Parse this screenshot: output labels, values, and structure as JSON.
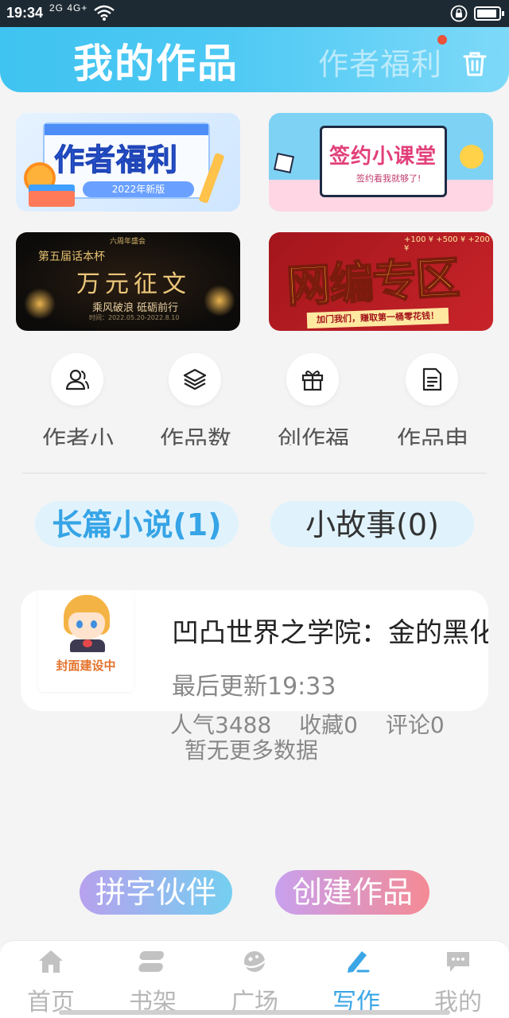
{
  "status": {
    "time": "19:34",
    "network": "2G 4G+"
  },
  "header": {
    "title": "我的作品",
    "welfare_link": "作者福利"
  },
  "banners": [
    {
      "title": "作者福利",
      "subtitle": "2022年新版"
    },
    {
      "title": "签约小课堂",
      "subtitle": "签约看我就够了!"
    },
    {
      "top_note": "六周年盛会",
      "left_text": "第五届话本杯",
      "title": "万元征文",
      "subtitle": "乘风破浪 砥砺前行",
      "date": "时间：2022.05.20-2022.8.10"
    },
    {
      "title": "网编专区",
      "ribbon": "加门我们，赚取第一桶零花钱！",
      "score": "+100 ¥   +500 ¥   +200 ¥"
    }
  ],
  "quick_links": [
    {
      "label": "作者小",
      "icon": "user-icon"
    },
    {
      "label": "作品数",
      "icon": "layers-icon"
    },
    {
      "label": "创作福",
      "icon": "gift-icon"
    },
    {
      "label": "作品申",
      "icon": "document-icon"
    }
  ],
  "tabs": [
    {
      "label": "长篇小说(1)",
      "active": true
    },
    {
      "label": "小故事(0)",
      "active": false
    }
  ],
  "work": {
    "cover_label": "封面建设中",
    "title": "凹凸世界之学院：金的黑化",
    "last_update": "最后更新19:33",
    "popularity": "人气3488",
    "favorites": "收藏0",
    "comments": "评论0"
  },
  "no_more": "暂无更多数据",
  "actions": {
    "partner": "拼字伙伴",
    "create": "创建作品"
  },
  "nav": [
    {
      "label": "首页",
      "icon": "home-icon"
    },
    {
      "label": "书架",
      "icon": "bookshelf-icon"
    },
    {
      "label": "广场",
      "icon": "planet-icon"
    },
    {
      "label": "写作",
      "icon": "pen-icon",
      "active": true
    },
    {
      "label": "我的",
      "icon": "chat-icon"
    }
  ],
  "colors": {
    "header_gradient_start": "#3fc3f0",
    "active_blue": "#3aa6e6",
    "nav_inactive": "#b7b7b7"
  }
}
